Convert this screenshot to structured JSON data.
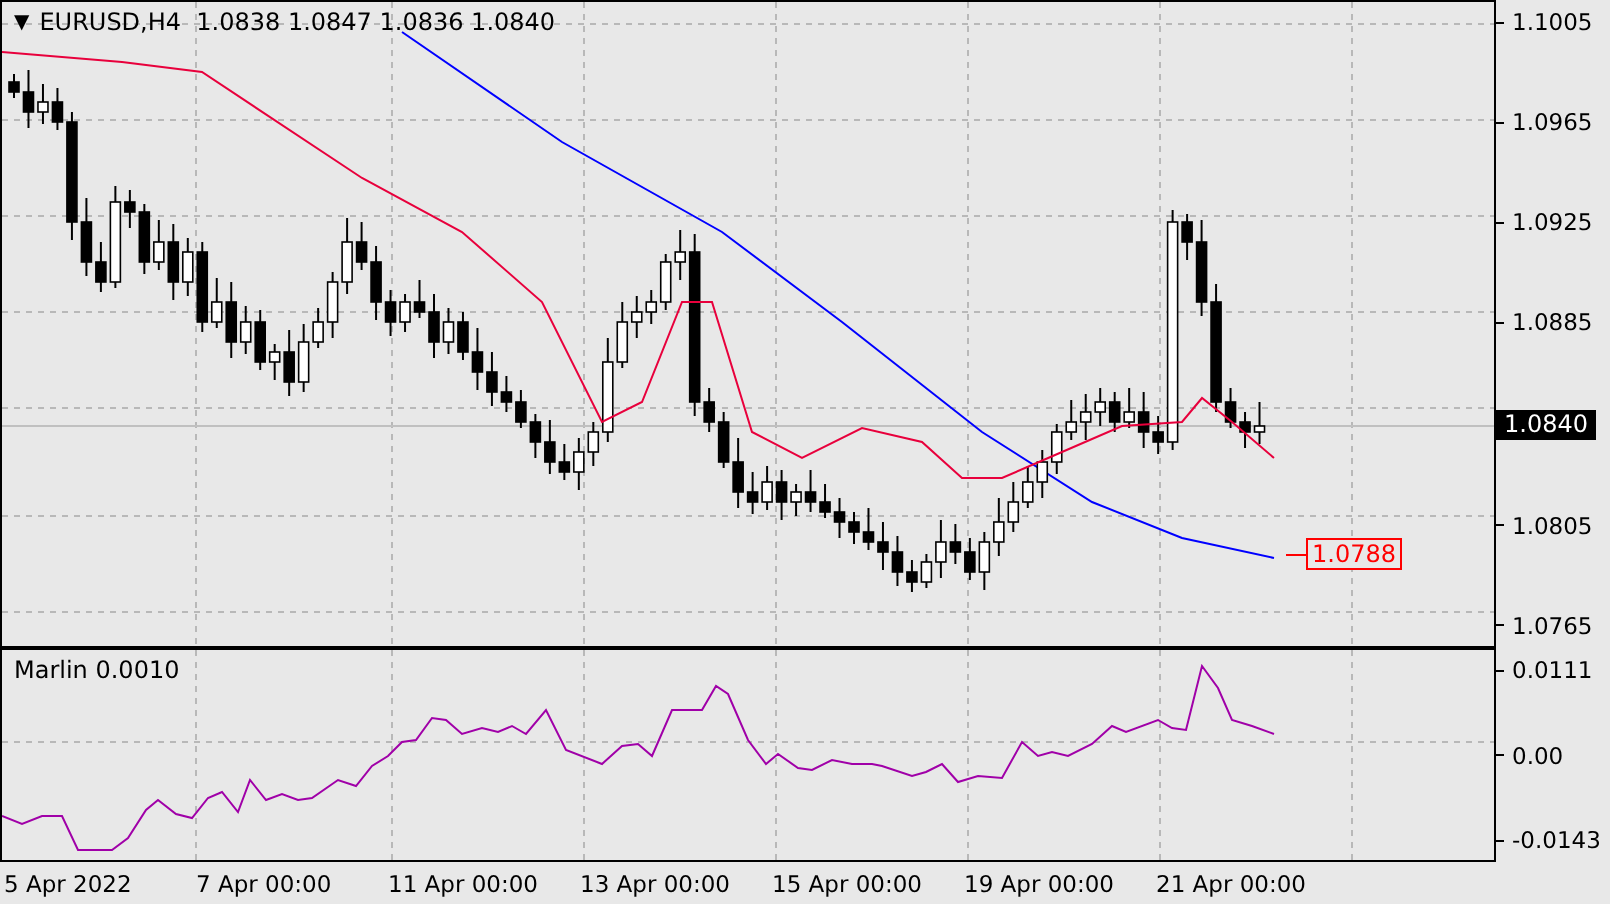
{
  "price_panel": {
    "collapse_glyph": "▼",
    "title": "EURUSD,H4  1.0838 1.0847 1.0836 1.0840",
    "level_tag": "1.0788"
  },
  "price_axis": [
    {
      "kind": "tick",
      "label": "1.1005"
    },
    {
      "kind": "tick",
      "label": "1.0965"
    },
    {
      "kind": "tick",
      "label": "1.0925"
    },
    {
      "kind": "tick",
      "label": "1.0885"
    },
    {
      "kind": "current",
      "label": "1.0840"
    },
    {
      "kind": "tick",
      "label": "1.0805"
    },
    {
      "kind": "tick",
      "label": "1.0765"
    }
  ],
  "indicator_panel": {
    "title": "Marlin 0.0010"
  },
  "indicator_axis": [
    "0.0111",
    "0.00",
    "-0.0143"
  ],
  "time_axis": [
    "5 Apr 2022",
    "7 Apr 00:00",
    "11 Apr 00:00",
    "13 Apr 00:00",
    "15 Apr 00:00",
    "19 Apr 00:00",
    "21 Apr 00:00"
  ]
}
